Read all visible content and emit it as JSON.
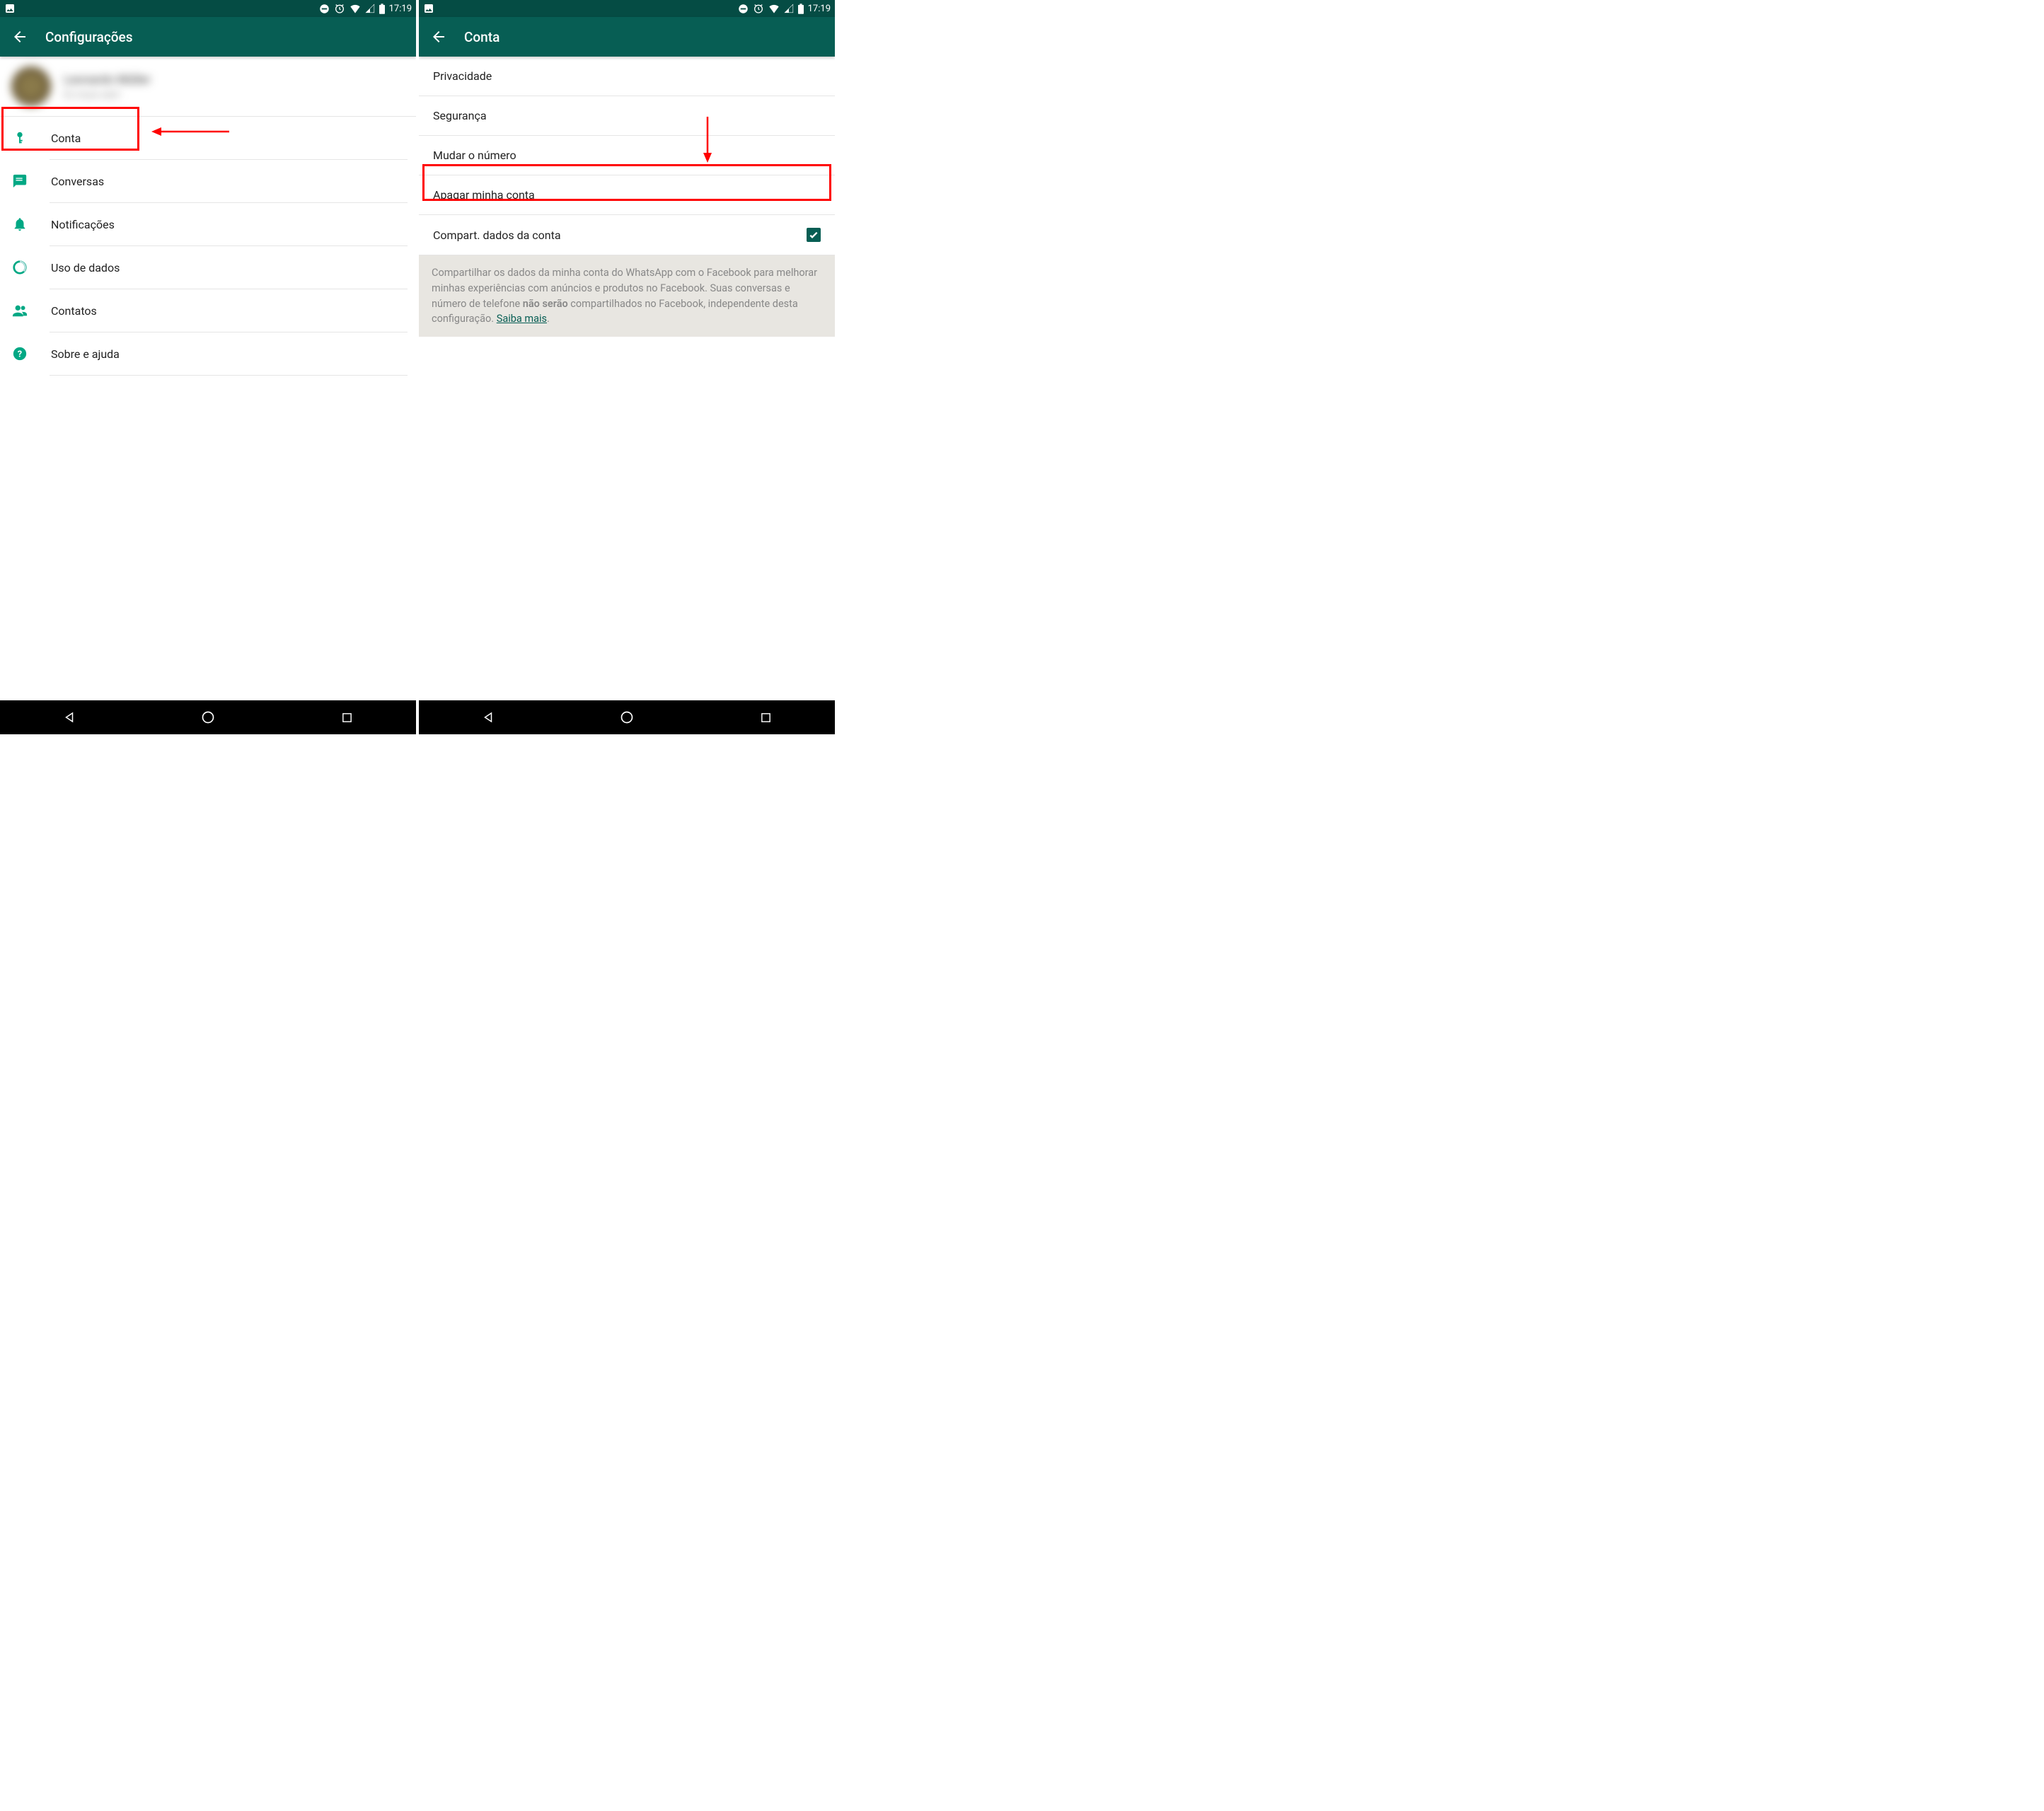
{
  "status": {
    "time": "17:19"
  },
  "left": {
    "title": "Configurações",
    "profile": {
      "name": "Leonardo Müller",
      "status": "Es muss sein!"
    },
    "menu": {
      "conta": "Conta",
      "conversas": "Conversas",
      "notificacoes": "Notificações",
      "uso_dados": "Uso de dados",
      "contatos": "Contatos",
      "sobre": "Sobre e ajuda"
    }
  },
  "right": {
    "title": "Conta",
    "items": {
      "privacidade": "Privacidade",
      "seguranca": "Segurança",
      "mudar_numero": "Mudar o número",
      "apagar_conta": "Apagar minha conta",
      "compart_dados": "Compart. dados da conta"
    },
    "info": {
      "p1": "Compartilhar os dados da minha conta do WhatsApp com o Facebook para melhorar minhas experiências com anúncios e produtos no Facebook. Suas conversas e número de telefone ",
      "bold": "não serão",
      "p2": " compartilhados no Facebook, independente desta configuração. ",
      "link": "Saiba mais"
    }
  }
}
